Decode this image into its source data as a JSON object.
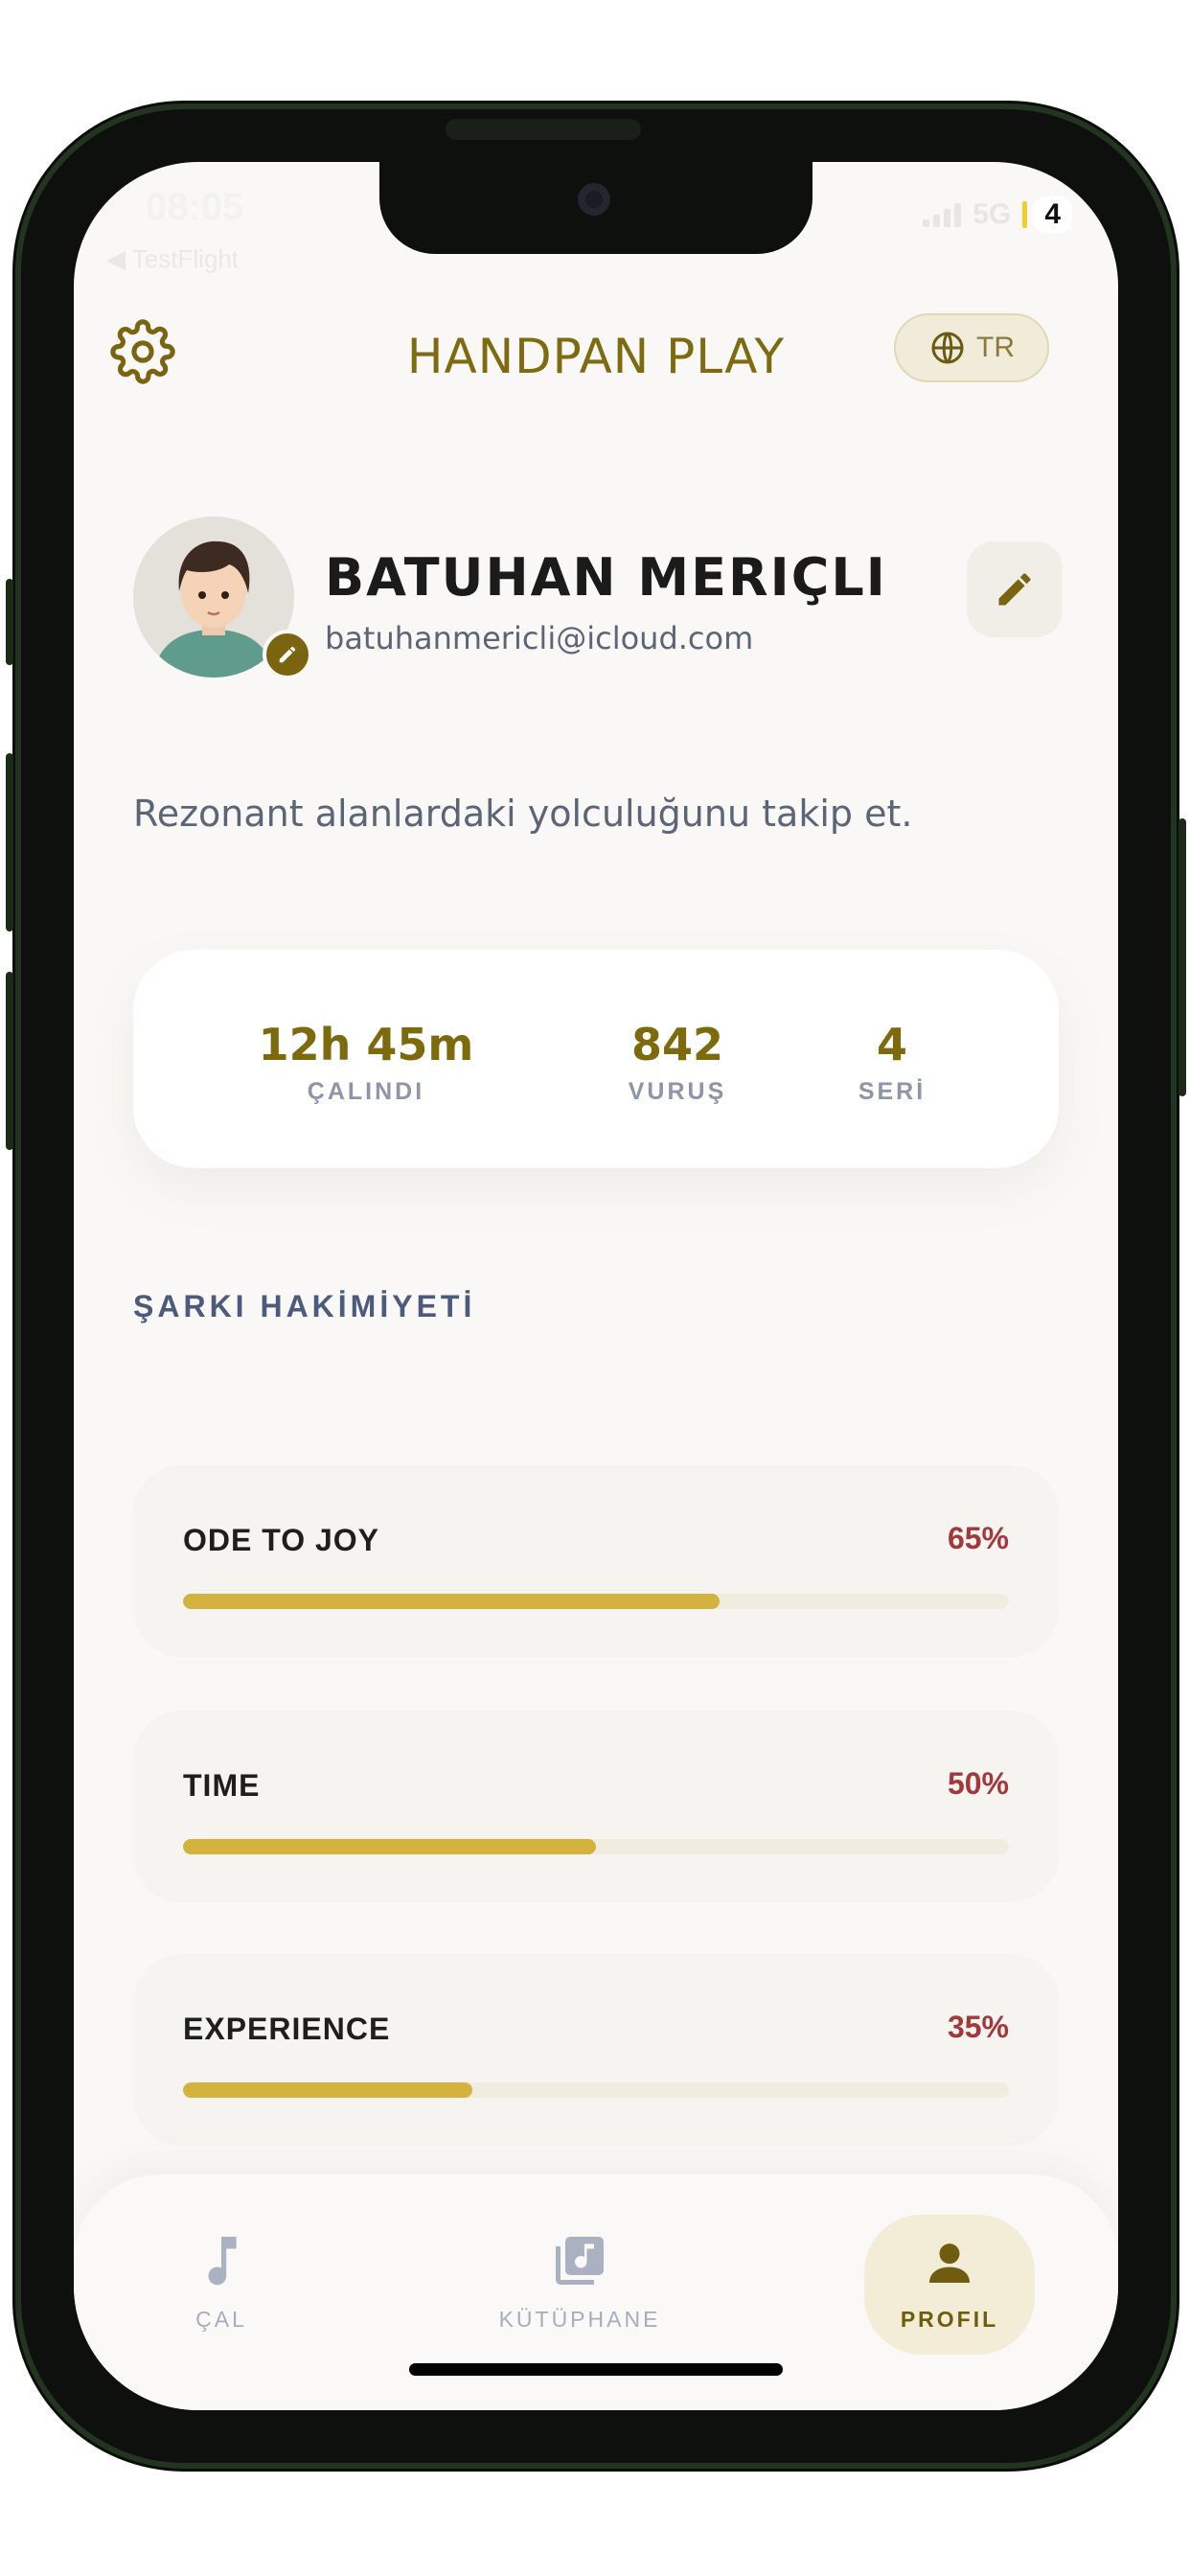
{
  "status_bar": {
    "time": "08:05",
    "back_label": "◀ TestFlight",
    "network": "5G",
    "battery": "4"
  },
  "header": {
    "title": "HANDPAN PLAY",
    "language": "TR"
  },
  "profile": {
    "name": "BATUHAN MERIÇLI",
    "email": "batuhanmericli@icloud.com"
  },
  "tagline": "Rezonant alanlardaki yolculuğunu takip et.",
  "stats": [
    {
      "value": "12h 45m",
      "label": "ÇALINDI"
    },
    {
      "value": "842",
      "label": "VURUŞ"
    },
    {
      "value": "4",
      "label": "SERİ"
    }
  ],
  "mastery": {
    "title": "ŞARKI HAKİMİYETİ",
    "songs": [
      {
        "name": "ODE TO JOY",
        "percent_label": "65%",
        "progress": 0.65
      },
      {
        "name": "TIME",
        "percent_label": "50%",
        "progress": 0.5
      },
      {
        "name": "EXPERIENCE",
        "percent_label": "35%",
        "progress": 0.35
      }
    ]
  },
  "tabs": [
    {
      "label": "ÇAL",
      "icon": "music-note-icon"
    },
    {
      "label": "KÜTÜPHANE",
      "icon": "music-library-icon"
    },
    {
      "label": "PROFIL",
      "icon": "person-icon",
      "active": true
    }
  ],
  "colors": {
    "accent": "#7d6a0d",
    "progress_fill": "#d3b23e",
    "percent": "#a3383c",
    "active_tab_bg": "#f3ecd6"
  }
}
